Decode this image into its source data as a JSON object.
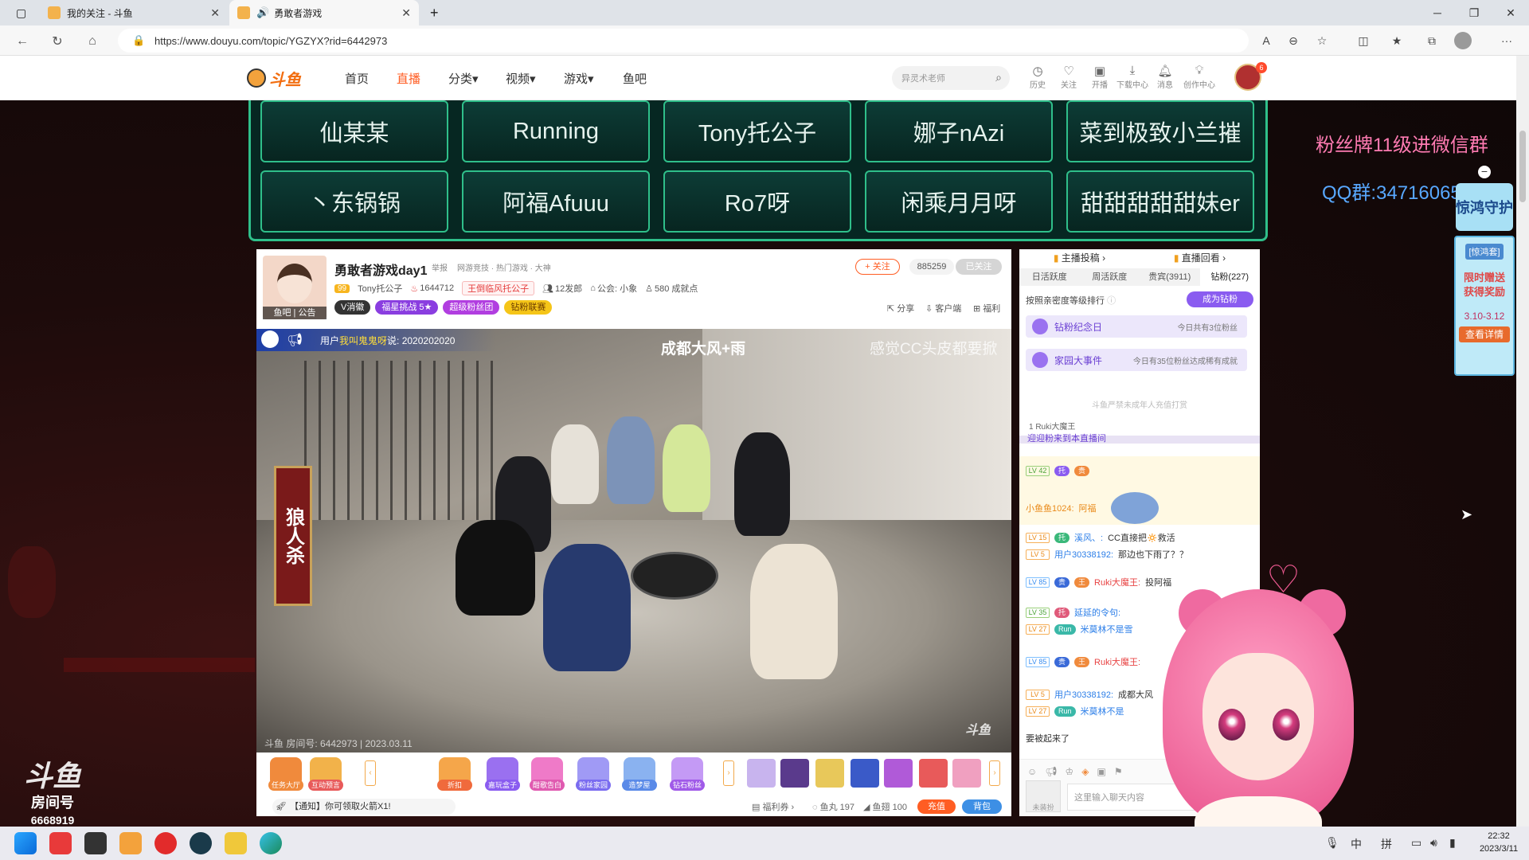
{
  "browser": {
    "tabs": [
      {
        "title": "我的关注 - 斗鱼",
        "active": false
      },
      {
        "title": "勇敢者游戏",
        "active": true
      }
    ],
    "url": "https://www.douyu.com/topic/YGZYX?rid=6442973"
  },
  "header": {
    "nav": [
      "首页",
      "直播",
      "分类",
      "视频",
      "游戏",
      "鱼吧"
    ],
    "search_placeholder": "异灵术老师",
    "icons": [
      {
        "icon": "history-icon",
        "label": "历史"
      },
      {
        "icon": "heart-icon",
        "label": "关注"
      },
      {
        "icon": "broadcast-icon",
        "label": "开播"
      },
      {
        "icon": "download-icon",
        "label": "下载中心"
      },
      {
        "icon": "bell-icon",
        "label": "消息"
      },
      {
        "icon": "bulb-icon",
        "label": "创作中心"
      }
    ],
    "avatar_badge": "6"
  },
  "streamers": [
    "仙某某",
    "Running",
    "Tony托公子",
    "娜子nAzi",
    "菜到极致小兰摧",
    "丶东锅锅",
    "阿福Afuuu",
    "Ro7呀",
    "闲乘月月呀",
    "甜甜甜甜甜妹er"
  ],
  "side_text": {
    "fan": "粉丝牌11级进微信群",
    "qq": "QQ群:347160654"
  },
  "promo": {
    "head": "惊鸿守护",
    "tag": "[惊鸿套]",
    "line1": "限时赠送",
    "line2": "获得奖励",
    "date": "3.10-3.12",
    "cta": "查看详情"
  },
  "room": {
    "title": "勇敢者游戏day1",
    "report": "举报",
    "category": "网游竞技 · 热门游戏 · 大神",
    "avatar_label": "鱼吧 | 公告",
    "level": "99",
    "host": "Tony托公子",
    "heat": "1644712",
    "honor": "王倒临风托公子",
    "fans_group": "12发郎",
    "guild": "公会: 小象",
    "achievements": "580 成就点",
    "pills": [
      "V消徽",
      "福星挑战 5★",
      "超级粉丝团",
      "钻粉联赛"
    ],
    "follow": "+ 关注",
    "follow_count": "885259",
    "followed": "已关注",
    "actions": [
      "分享",
      "客户端",
      "福利"
    ]
  },
  "video": {
    "notice_prefix": "用户",
    "notice_user": "我叫鬼鬼呀",
    "notice_text": "说: 2020202020",
    "overlay_1": "成都大风+雨",
    "overlay_2": "感觉CC头皮都要掀",
    "banner": "狼人杀",
    "room_id": "斗鱼 房间号: 6442973 | 2023.03.11",
    "logo": "斗鱼"
  },
  "gifts": [
    {
      "label": "任务大厅",
      "color": "#f08a3c"
    },
    {
      "label": "互动预言",
      "color": "#e85a5a"
    },
    {
      "label": "折扣",
      "color": "#f06a3c"
    },
    {
      "label": "嘉玩盒子",
      "color": "#8a5cf0"
    },
    {
      "label": "酣歌告白",
      "color": "#e05ab0"
    },
    {
      "label": "粉丝家园",
      "color": "#7a6cf0"
    },
    {
      "label": "造梦屋",
      "color": "#5a8ae8"
    },
    {
      "label": "钻石粉丝",
      "color": "#a05ae8"
    }
  ],
  "bottom": {
    "notice": "【通知】你可领取火箭X1!",
    "welfare": "福利券",
    "fishball": "鱼丸 197",
    "fishwing": "鱼翅 100",
    "recharge": "充值",
    "bag": "背包"
  },
  "chat": {
    "top_tabs": [
      "主播投稿",
      "直播回看"
    ],
    "rank_tabs": [
      "日活跃度",
      "周活跃度",
      "贵宾(3911)",
      "钻粉(227)"
    ],
    "rank_info": "按照亲密度等级排行",
    "fan_button": "成为钻粉",
    "events": [
      {
        "title": "钻粉纪念日",
        "sub": "今日共有3位粉丝"
      },
      {
        "title": "家园大事件",
        "sub": "今日有35位粉丝达成稀有成就"
      }
    ],
    "faint": "斗鱼严禁未成年人充值打赏",
    "rank_line": "1  Ruki大魔王",
    "cut_line": "迎迎粉来到本直播间",
    "messages": [
      {
        "lv": "LV 42",
        "user": "小鱼鱼1024:",
        "text": "阿福"
      },
      {
        "lv": "LV 15",
        "user": "溪风、:",
        "text": "CC直接把🔅救活"
      },
      {
        "lv": "LV 5",
        "user": "用户30338192:",
        "text": "那边也下雨了？？"
      },
      {
        "lv": "LV 85",
        "user": "Ruki大魔王:",
        "text": "投阿福"
      },
      {
        "lv": "LV 35",
        "user": "延延的令句:",
        "text": ""
      },
      {
        "lv": "LV 27",
        "user": "米莫林不是雪",
        "text": ""
      },
      {
        "lv": "LV 85",
        "user": "Ruki大魔王:",
        "text": ""
      },
      {
        "lv": "LV 5",
        "user": "用户30338192:",
        "text": "成都大风"
      },
      {
        "lv": "LV 27",
        "user": "米莫林不是",
        "text": ""
      }
    ],
    "last_text": "要被起来了",
    "input_placeholder": "这里输入聊天内容",
    "avatar_label": "未装扮"
  },
  "taskbar": {
    "ime": [
      "中",
      "拼"
    ],
    "time": "22:32",
    "date": "2023/3/11"
  },
  "watermark": {
    "brand": "斗鱼",
    "label": "房间号",
    "room": "6668919"
  }
}
